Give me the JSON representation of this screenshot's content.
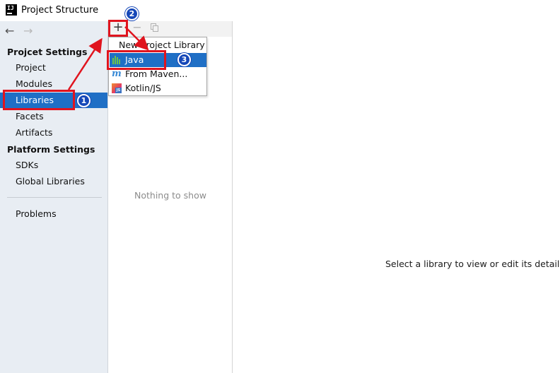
{
  "window": {
    "title": "Project Structure"
  },
  "sidebar": {
    "nav_back": "←",
    "nav_forward": "→",
    "project_settings_header": "Projcet Settings",
    "project_settings_items": [
      {
        "label": "Project",
        "selected": false
      },
      {
        "label": "Modules",
        "selected": false
      },
      {
        "label": "Libraries",
        "selected": true
      },
      {
        "label": "Facets",
        "selected": false
      },
      {
        "label": "Artifacts",
        "selected": false
      }
    ],
    "platform_settings_header": "Platform Settings",
    "platform_settings_items": [
      {
        "label": "SDKs"
      },
      {
        "label": "Global Libraries"
      }
    ],
    "problems_label": "Problems"
  },
  "toolbar": {
    "add_label": "+",
    "remove_label": "−"
  },
  "library_list": {
    "empty_text": "Nothing to show"
  },
  "popup": {
    "title": "New Project Library",
    "items": [
      {
        "label": "Java",
        "icon": "java-library-icon",
        "selected": true
      },
      {
        "label": "From Maven...",
        "icon": "maven-icon",
        "selected": false
      },
      {
        "label": "Kotlin/JS",
        "icon": "kotlin-js-icon",
        "selected": false
      }
    ]
  },
  "detail": {
    "placeholder": "Select a library to view or edit its details he"
  },
  "annotations": {
    "badges": [
      "1",
      "2",
      "3"
    ],
    "colors": {
      "highlight": "#e0141e",
      "badge": "#1547b8",
      "selection": "#1f6fc5"
    }
  }
}
